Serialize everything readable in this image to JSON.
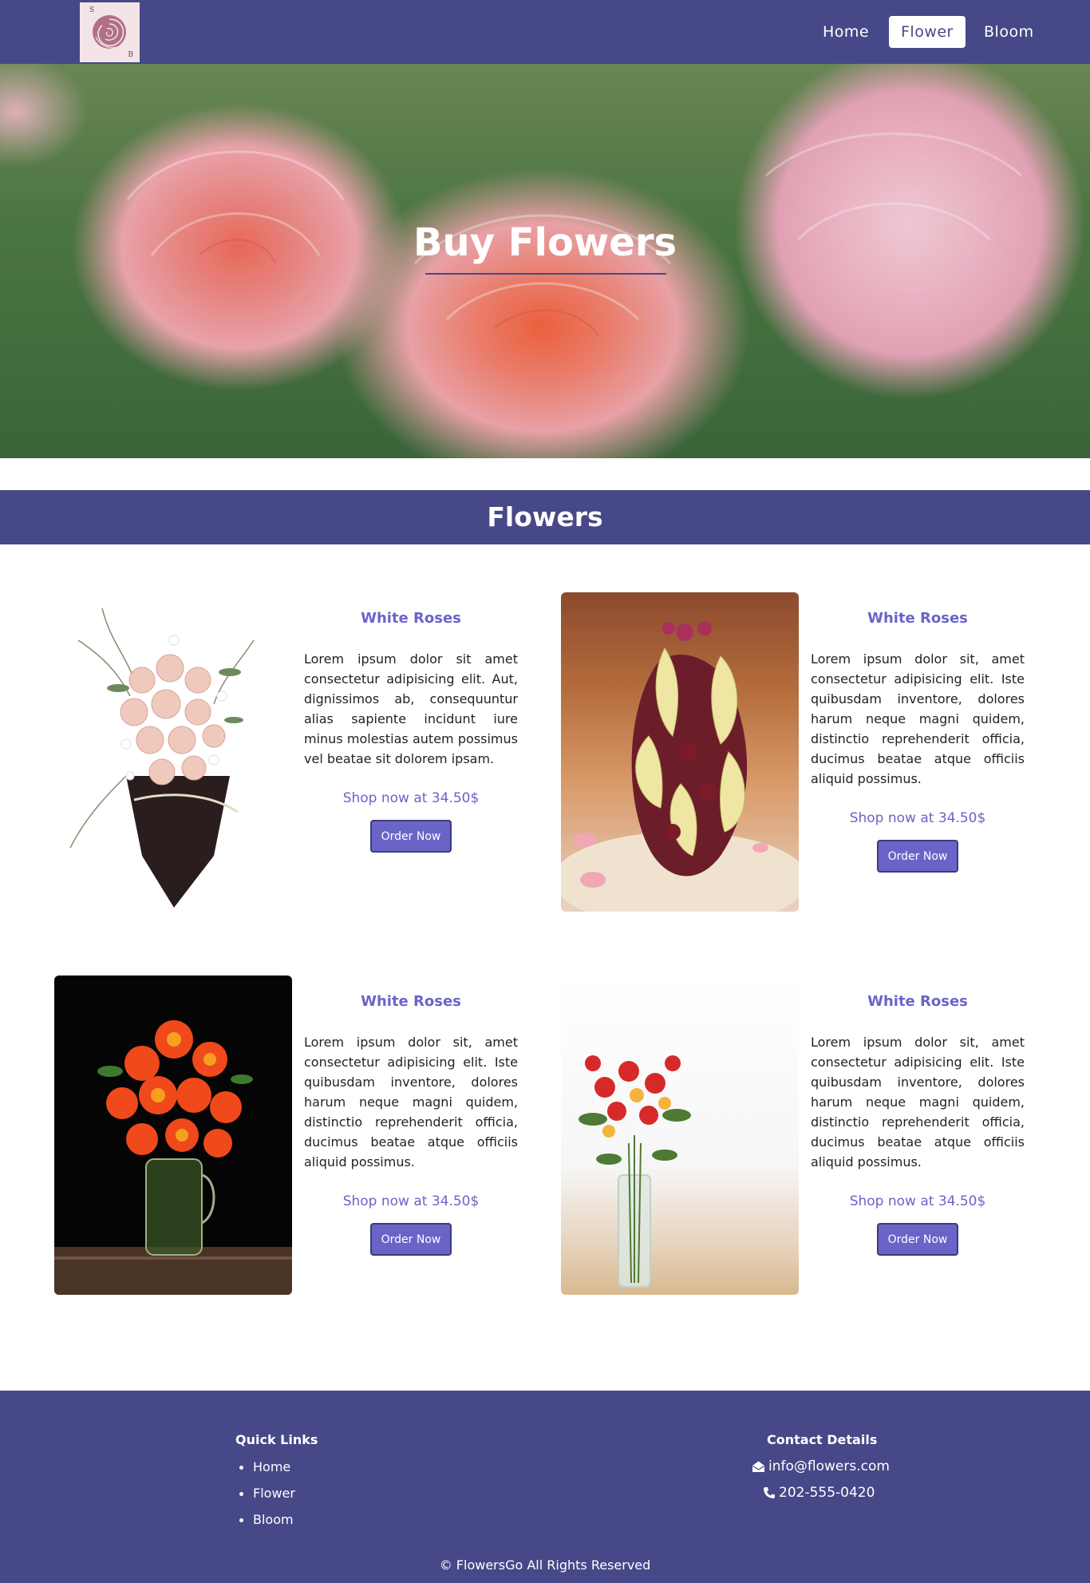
{
  "nav": {
    "logo_letter_top": "S",
    "logo_letter_bottom": "B",
    "links": [
      {
        "label": "Home"
      },
      {
        "label": "Flower"
      },
      {
        "label": "Bloom"
      }
    ],
    "active": "Flower"
  },
  "hero": {
    "title": "Buy Flowers"
  },
  "section": {
    "title": "Flowers"
  },
  "products": [
    {
      "title": "White Roses",
      "description": "Lorem ipsum dolor sit amet consectetur adipisicing elit. Aut, dignissimos ab, consequuntur alias sapiente incidunt iure minus molestias autem possimus vel beatae sit dolorem ipsam.",
      "price": "Shop now at 34.50$",
      "button": "Order Now"
    },
    {
      "title": "White Roses",
      "description": "Lorem ipsum dolor sit, amet consectetur adipisicing elit. Iste quibusdam inventore, dolores harum neque magni quidem, distinctio reprehenderit officia, ducimus beatae atque officiis aliquid possimus.",
      "price": "Shop now at 34.50$",
      "button": "Order Now"
    },
    {
      "title": "White Roses",
      "description": "Lorem ipsum dolor sit, amet consectetur adipisicing elit. Iste quibusdam inventore, dolores harum neque magni quidem, distinctio reprehenderit officia, ducimus beatae atque officiis aliquid possimus.",
      "price": "Shop now at 34.50$",
      "button": "Order Now"
    },
    {
      "title": "White Roses",
      "description": "Lorem ipsum dolor sit, amet consectetur adipisicing elit. Iste quibusdam inventore, dolores harum neque magni quidem, distinctio reprehenderit officia, ducimus beatae atque officiis aliquid possimus.",
      "price": "Shop now at 34.50$",
      "button": "Order Now"
    }
  ],
  "footer": {
    "quick_links_title": "Quick Links",
    "quick_links": [
      "Home",
      "Flower",
      "Bloom"
    ],
    "contact_title": "Contact Details",
    "email": "info@flowers.com",
    "phone": "202-555-0420",
    "copyright": "© FlowersGo All Rights Reserved"
  },
  "colors": {
    "primary": "#474888",
    "accent": "#6a64c9",
    "white": "#ffffff"
  },
  "icons": {
    "email": "envelope-open-icon",
    "phone": "phone-icon"
  }
}
